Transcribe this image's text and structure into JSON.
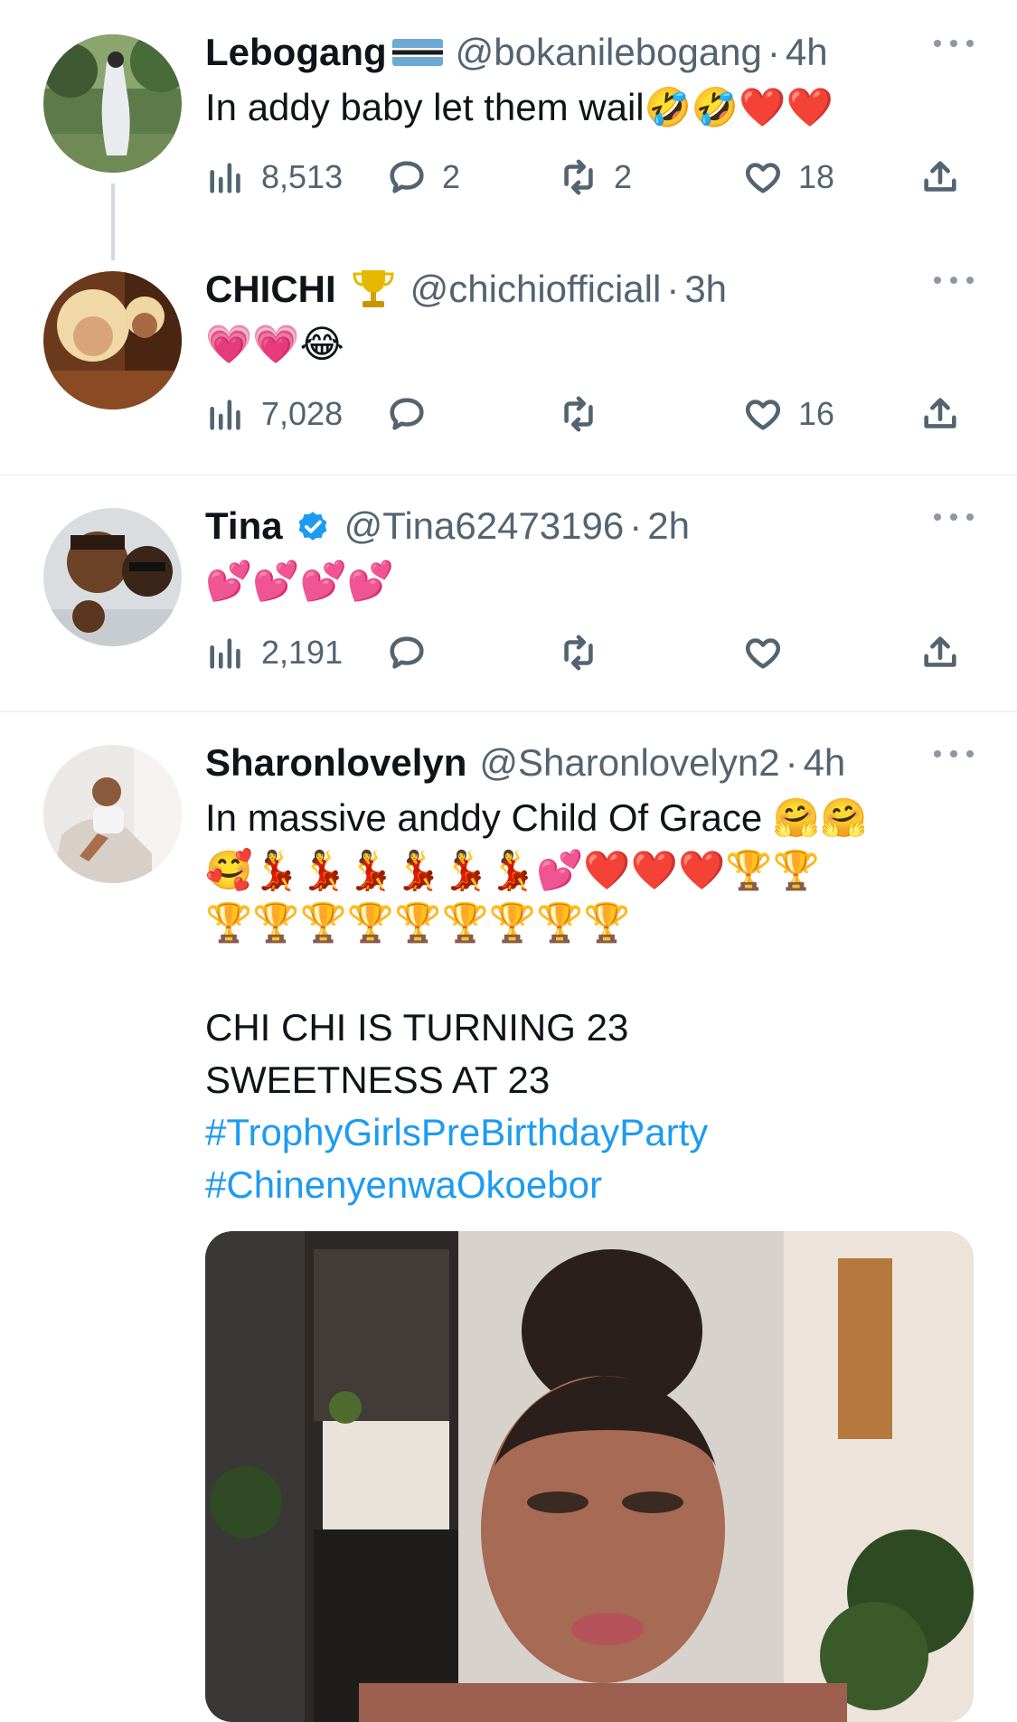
{
  "tweets": [
    {
      "name": "Lebogang",
      "handle": "@bokanilebogang",
      "time": "4h",
      "text": "In addy baby let them wail🤣🤣❤️❤️",
      "views": "8,513",
      "replies": "2",
      "retweets": "2",
      "likes": "18"
    },
    {
      "name": "CHICHI",
      "handle": "@chichiofficiall",
      "time": "3h",
      "text": "💗💗😂",
      "views": "7,028",
      "replies": "",
      "retweets": "",
      "likes": "16"
    },
    {
      "name": "Tina",
      "handle": "@Tina62473196",
      "time": "2h",
      "text": "💕💕💕💕",
      "views": "2,191",
      "replies": "",
      "retweets": "",
      "likes": ""
    },
    {
      "name": "Sharonlovelyn",
      "handle": "@Sharonlovelyn2",
      "time": "4h",
      "line1": "In massive anddy Child Of Grace 🤗🤗",
      "line2": "🥰💃💃💃💃💃💃💕❤️❤️❤️🏆🏆",
      "line3": "🏆🏆🏆🏆🏆🏆🏆🏆🏆",
      "line4": "CHI CHI IS TURNING 23",
      "line5": "SWEETNESS AT 23",
      "hashtag1": "#TrophyGirlsPreBirthdayParty",
      "hashtag2": "#ChinenyenwaOkoebor"
    }
  ],
  "icons": {
    "views": "bar-chart-icon",
    "reply": "speech-bubble-icon",
    "retweet": "retweet-icon",
    "like": "heart-icon",
    "share": "share-icon",
    "more": "ellipsis-icon"
  },
  "colors": {
    "text": "#0f1419",
    "secondary": "#536471",
    "link": "#1d9bf0",
    "divider": "#eff3f4"
  }
}
